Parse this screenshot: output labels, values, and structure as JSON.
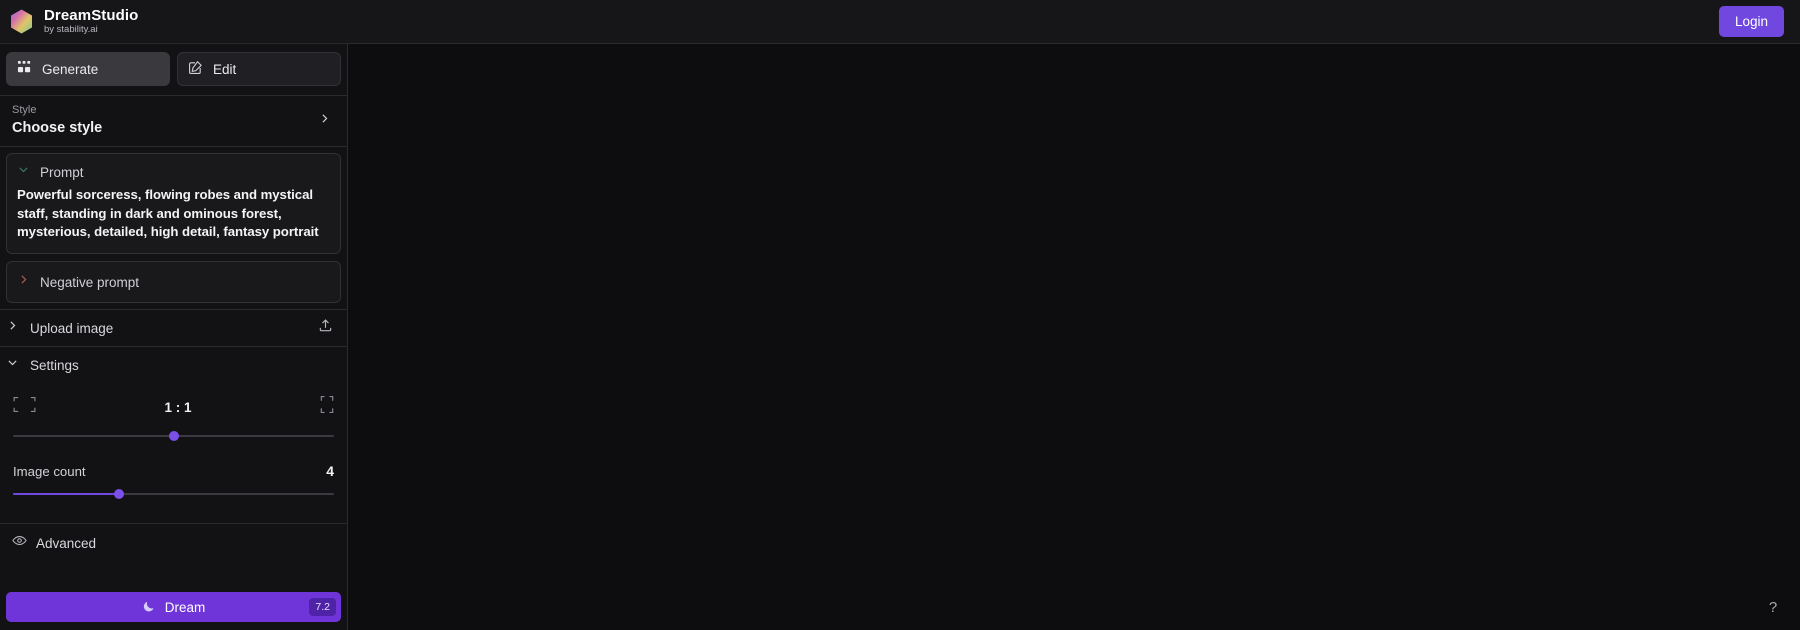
{
  "app": {
    "brand_title": "DreamStudio",
    "brand_subtitle": "by stability.ai",
    "login_label": "Login"
  },
  "modes": {
    "generate_label": "Generate",
    "edit_label": "Edit",
    "active": "Generate"
  },
  "style": {
    "label": "Style",
    "value": "Choose style"
  },
  "prompt": {
    "header": "Prompt",
    "text": "Powerful sorceress, flowing robes and mystical staff, standing in dark and ominous forest, mysterious, detailed, high detail, fantasy portrait"
  },
  "negative_prompt": {
    "header": "Negative prompt"
  },
  "upload": {
    "label": "Upload image"
  },
  "settings": {
    "label": "Settings",
    "aspect_ratio": "1 : 1",
    "aspect_ratio_percent": 50,
    "image_count_label": "Image count",
    "image_count_value": "4",
    "image_count_percent": 33
  },
  "advanced": {
    "label": "Advanced"
  },
  "dream": {
    "label": "Dream",
    "credits": "7.2"
  },
  "help": {
    "label": "?"
  },
  "colors": {
    "accent": "#7048e0",
    "dream_button": "#6f35d8",
    "prompt_chevron": "#3f7a5e",
    "negative_chevron": "#b05a4e",
    "background": "#0d0d0f",
    "sidebar": "#121214"
  }
}
